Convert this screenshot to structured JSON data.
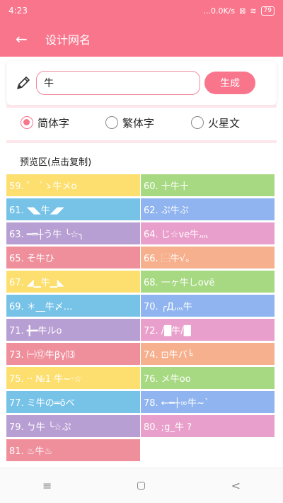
{
  "status": {
    "time": "4:23",
    "net": "...0.0K/s",
    "battery": "79"
  },
  "header": {
    "back_icon": "back-arrow-icon",
    "title": "设计网名"
  },
  "input": {
    "value": "牛",
    "generate_label": "生成",
    "pencil_icon": "pencil-icon",
    "border_color": "#f28a9c"
  },
  "colors": {
    "accent": "#f9758c"
  },
  "options": [
    {
      "label": "简体字",
      "checked": true
    },
    {
      "label": "繁体字",
      "checked": false
    },
    {
      "label": "火星文",
      "checked": false
    }
  ],
  "preview_title": "预览区(点击复制)",
  "results": [
    {
      "text": "59. ゜ `ゝ牛メo",
      "color": "#fddf6f"
    },
    {
      "text": "60. 十牛十",
      "color": "#a7d982"
    },
    {
      "text": "61. ◥◣牛◢◤",
      "color": "#77c3e8"
    },
    {
      "text": "62. ぷ牛ぷ",
      "color": "#8fb4ef"
    },
    {
      "text": "63. ━═┼う牛 ╰☆╮",
      "color": "#b89fd3"
    },
    {
      "text": "64. じ☆ve牛灬",
      "color": "#e99fcb"
    },
    {
      "text": "65. そ牛ひ",
      "color": "#ef8f9c"
    },
    {
      "text": "66. ⿱牛√。",
      "color": "#f7b08d"
    },
    {
      "text": "67. ◢▁牛▁◣",
      "color": "#fddf6f"
    },
    {
      "text": "68. 一ヶ牛しovë",
      "color": "#a7d982"
    },
    {
      "text": "69. ＊__牛〆...",
      "color": "#77c3e8"
    },
    {
      "text": "70. ╭Д灬牛",
      "color": "#8fb4ef"
    },
    {
      "text": "71. ╋━牛ルo",
      "color": "#b89fd3"
    },
    {
      "text": "72. /█牛/█",
      "color": "#e99fcb"
    },
    {
      "text": "73. ㈠⑫牛βγ⒀",
      "color": "#ef8f9c"
    },
    {
      "text": "74. ⊡牛バ╘",
      "color": "#f7b08d"
    },
    {
      "text": "75. ·· №1 牛~·☆",
      "color": "#fddf6f"
    },
    {
      "text": "76. メ牛oo",
      "color": "#a7d982"
    },
    {
      "text": "77. ミ牛の═ōベ",
      "color": "#77c3e8"
    },
    {
      "text": "78. ←━┼∞牛~`",
      "color": "#8fb4ef"
    },
    {
      "text": "79. ㄅ牛 ╰☆ぷ",
      "color": "#b89fd3"
    },
    {
      "text": "80. ;g_牛 ?",
      "color": "#e99fcb"
    },
    {
      "text": "81. ♨牛♨",
      "color": "#ef8f9c"
    }
  ],
  "navbar": {
    "menu_icon": "menu-icon",
    "home_icon": "home-icon",
    "back_icon": "back-icon",
    "menu_glyph": "≡",
    "back_glyph": "<"
  }
}
